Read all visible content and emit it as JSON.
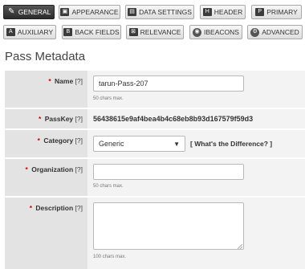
{
  "tabs_row1": [
    {
      "label": "GENERAL",
      "icon": "pencil-icon",
      "glyph": "✎"
    },
    {
      "label": "APPEARANCE",
      "icon": "image-icon",
      "glyph": "▣"
    },
    {
      "label": "DATA SETTINGS",
      "icon": "data-icon",
      "glyph": "▤"
    },
    {
      "label": "HEADER",
      "icon": "header-icon",
      "glyph": "H"
    },
    {
      "label": "PRIMARY",
      "icon": "primary-icon",
      "glyph": "P"
    }
  ],
  "tabs_row2": [
    {
      "label": "AUXILIARY",
      "icon": "auxiliary-icon",
      "glyph": "A"
    },
    {
      "label": "BACK FIELDS",
      "icon": "back-fields-icon",
      "glyph": "B"
    },
    {
      "label": "RELEVANCE",
      "icon": "relevance-icon",
      "glyph": "⊠"
    },
    {
      "label": "IBEACONS",
      "icon": "ibeacon-icon",
      "glyph": "◉"
    },
    {
      "label": "ADVANCED",
      "icon": "gear-icon",
      "glyph": "⚙"
    }
  ],
  "heading": "Pass Metadata",
  "form": {
    "name": {
      "label": "Name",
      "help": "[?]",
      "value": "tarun-Pass-207",
      "hint": "50 chars max."
    },
    "passkey": {
      "label": "PassKey",
      "help": "[?]",
      "value": "56438615e9af4bea4b4c68eb8b93d167579f59d3"
    },
    "category": {
      "label": "Category",
      "help": "[?]",
      "value": "Generic",
      "link": "[ What's the Difference? ]"
    },
    "organization": {
      "label": "Organization",
      "help": "[?]",
      "value": "",
      "hint": "50 chars max."
    },
    "description": {
      "label": "Description",
      "help": "[?]",
      "value": "",
      "hint": "100 chars max."
    }
  },
  "colors": {
    "required": "#d00000",
    "active_tab": "#2c2c2c"
  }
}
